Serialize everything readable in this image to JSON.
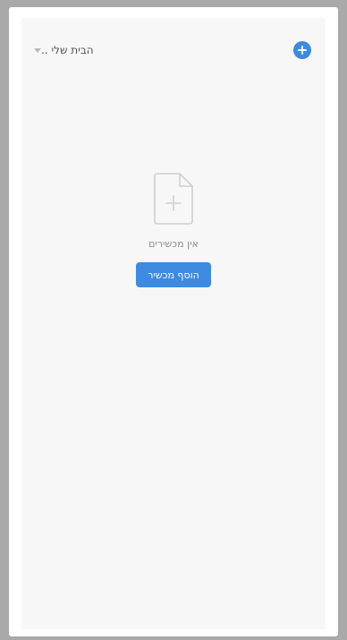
{
  "header": {
    "home_title": "הבית שלי ..",
    "home_caret_icon": "caret-down-icon",
    "add_icon": "plus-circle-icon"
  },
  "empty_state": {
    "icon": "add-file-icon",
    "message": "אין מכשירים",
    "add_device_label": "הוסף מכשיר"
  },
  "colors": {
    "accent": "#3d8ae3",
    "background": "#f7f7f7",
    "frame": "#a9a9a9",
    "muted_text": "#8c8c8c",
    "icon_stroke": "#cfcfd4"
  }
}
